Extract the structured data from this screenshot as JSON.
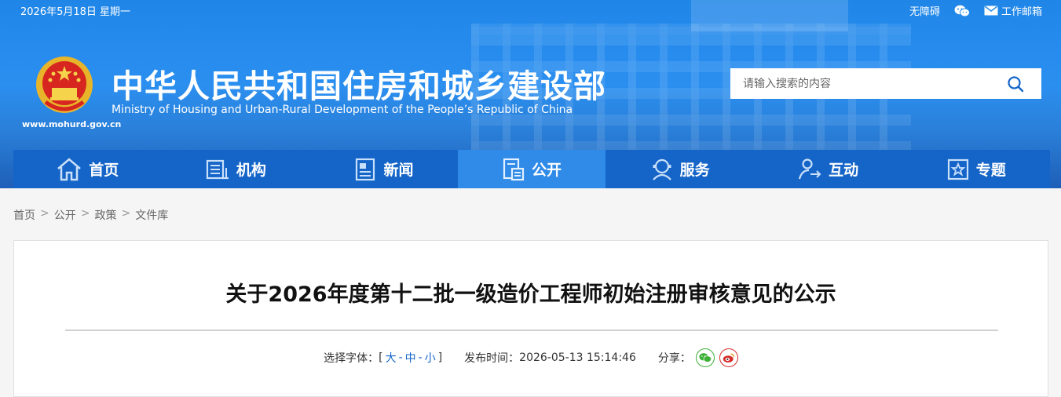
{
  "topbar": {
    "date": "2026年5月18日 星期一",
    "accessibility": "无障碍",
    "mail": "工作邮箱"
  },
  "header": {
    "site_url": "www.mohurd.gov.cn",
    "title_cn": "中华人民共和国住房和城乡建设部",
    "title_en": "Ministry of Housing and Urban-Rural Development of the People’s Republic of China"
  },
  "search": {
    "placeholder": "请输入搜索的内容"
  },
  "nav": {
    "items": [
      {
        "label": "首页",
        "icon": "home-icon"
      },
      {
        "label": "机构",
        "icon": "building-icon"
      },
      {
        "label": "新闻",
        "icon": "newspaper-icon"
      },
      {
        "label": "公开",
        "icon": "document-icon"
      },
      {
        "label": "服务",
        "icon": "service-icon"
      },
      {
        "label": "互动",
        "icon": "interaction-icon"
      },
      {
        "label": "专题",
        "icon": "topic-icon"
      }
    ],
    "active": "公开"
  },
  "breadcrumb": [
    "首页",
    "公开",
    "政策",
    "文件库"
  ],
  "breadcrumb_sep": ">",
  "article": {
    "title": "关于2026年度第十二批一级造价工程师初始注册审核意见的公示",
    "font_label": "选择字体：",
    "bracket_open": "[",
    "bracket_close": "]",
    "font_large": "大",
    "font_medium": "中",
    "font_small": "小",
    "font_dash": "-",
    "published_label": "发布时间：",
    "published_time": "2026-05-13 15:14:46",
    "share_label": "分享："
  },
  "colors": {
    "nav_bg": "#1565c8",
    "nav_active": "#2f8ae8",
    "wechat": "#3cb035",
    "weibo": "#d62b2b"
  }
}
